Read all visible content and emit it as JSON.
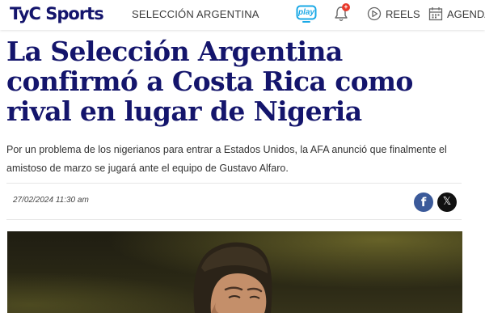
{
  "header": {
    "logo": "TyC Sports",
    "section": "SELECCIÓN ARGENTINA",
    "play_label": "play",
    "notification_count": "+",
    "reels_label": "REELS",
    "agenda_label": "AGENDA"
  },
  "article": {
    "title": "La Selección Argentina confirmó a Costa Rica como rival en lugar de Nigeria",
    "lead": "Por un problema de los nigerianos para entrar a Estados Unidos, la AFA anunció que finalmente el amistoso de marzo se jugará ante el equipo de Gustavo Alfaro.",
    "date": "27/02/2024 11:30 am",
    "share_facebook": "f",
    "share_x": "𝕏"
  },
  "colors": {
    "brand_navy": "#14156c",
    "play_blue": "#19a8e6",
    "badge_red": "#e83a2c",
    "facebook_blue": "#3b5a9a"
  }
}
